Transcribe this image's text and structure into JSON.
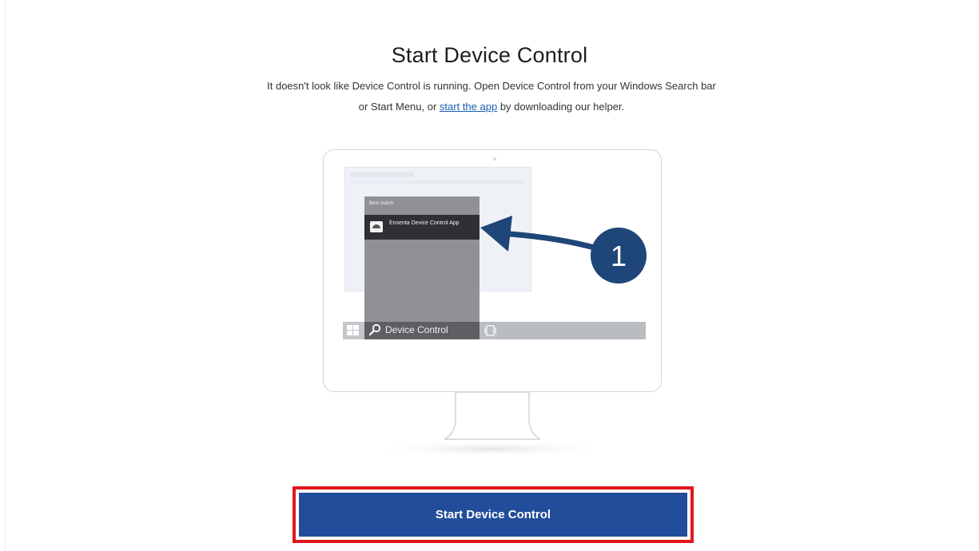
{
  "page": {
    "title": "Start Device Control",
    "description_before": "It doesn't look like Device Control is running. Open Device Control from your Windows Search bar or Start Menu, or ",
    "link_text": "start the app",
    "description_after": " by downloading our helper."
  },
  "illustration": {
    "menu_heading": "Best match",
    "result_label": "Ensenta Device Control App",
    "search_text": "Device Control",
    "step_number": "1"
  },
  "cta": {
    "label": "Start Device Control"
  },
  "colors": {
    "button": "#224d9b",
    "highlight": "#e2161c",
    "annotation": "#1f4679",
    "link": "#1a5fb4"
  },
  "icons": [
    "windows-logo-icon",
    "search-icon",
    "app-icon",
    "task-view-icon",
    "arrow-icon"
  ]
}
